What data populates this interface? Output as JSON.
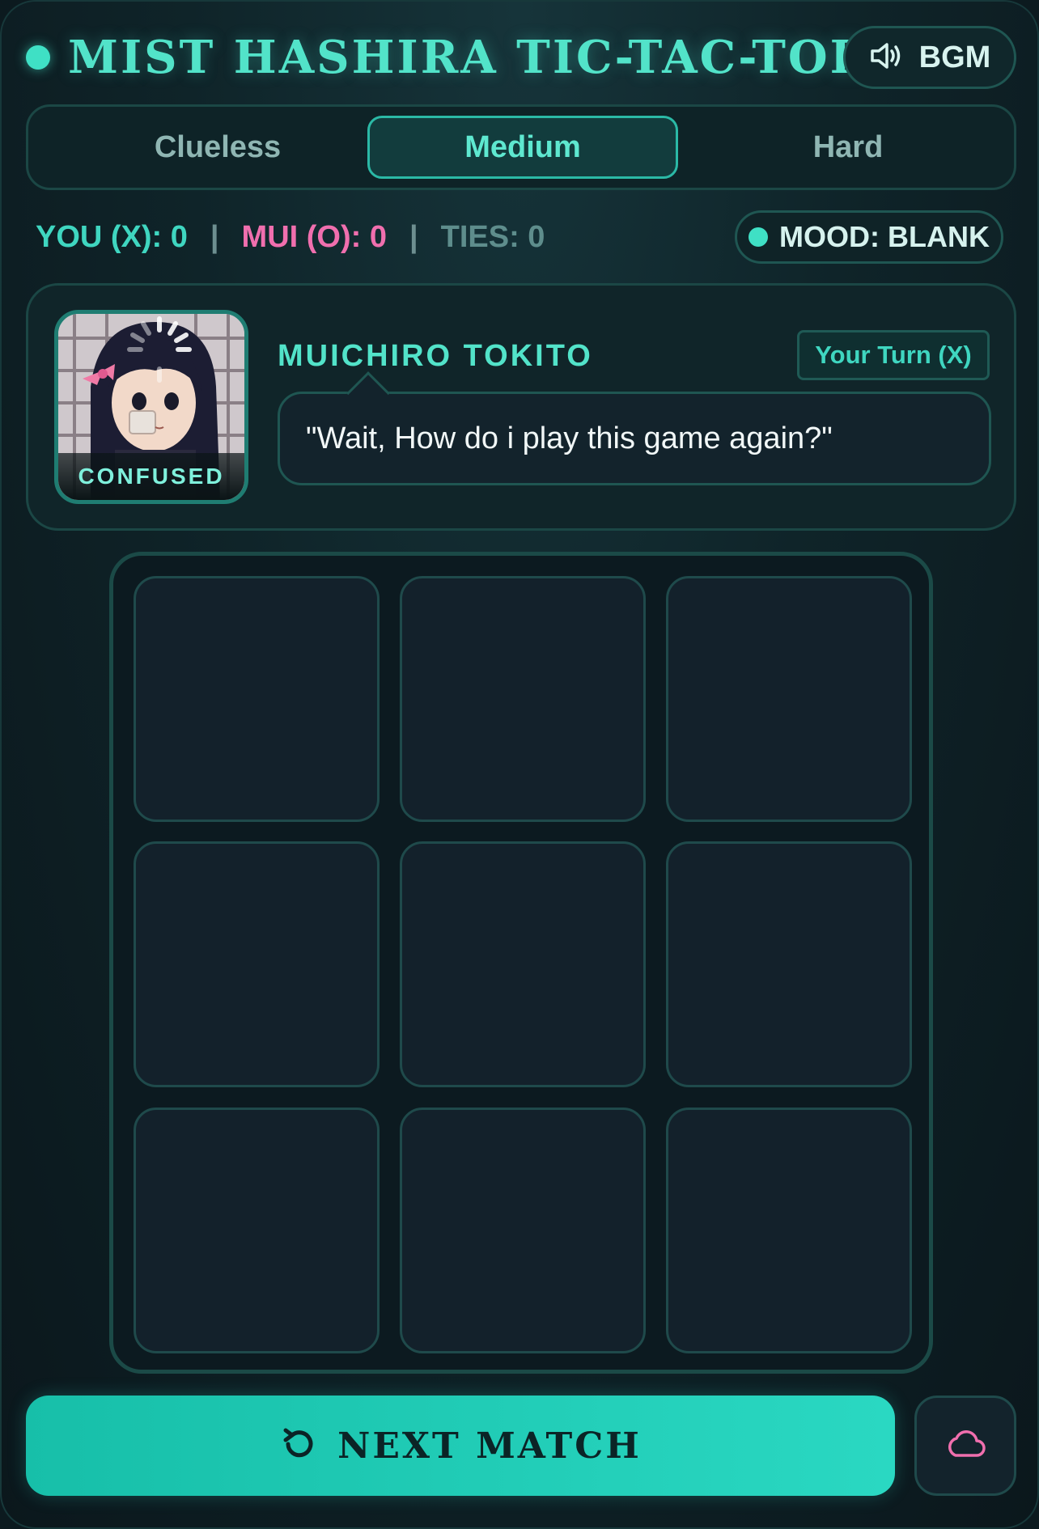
{
  "header": {
    "title": "Mist Hashira Tic-Tac-Toe",
    "bgm_label": "BGM",
    "bgm_icon": "speaker-icon"
  },
  "difficulty": {
    "options": [
      "Clueless",
      "Medium",
      "Hard"
    ],
    "selected": "Medium"
  },
  "score": {
    "you": "YOU (X): 0",
    "mui": "MUI (O): 0",
    "ties": "TIES: 0",
    "separator": "|"
  },
  "mood": {
    "label": "MOOD: BLANK"
  },
  "character": {
    "name": "MUICHIRO TOKITO",
    "expression": "CONFUSED",
    "turn": "Your Turn (X)",
    "speech": "\"Wait, How do i play this game again?\""
  },
  "board": {
    "cells": [
      "",
      "",
      "",
      "",
      "",
      "",
      "",
      "",
      ""
    ]
  },
  "footer": {
    "next_label": "Next Match",
    "next_icon": "restart-icon",
    "cloud_icon": "cloud-icon"
  },
  "colors": {
    "accent": "#3fe0c5",
    "opponent": "#f06fae",
    "background": "#0c1a1f"
  }
}
